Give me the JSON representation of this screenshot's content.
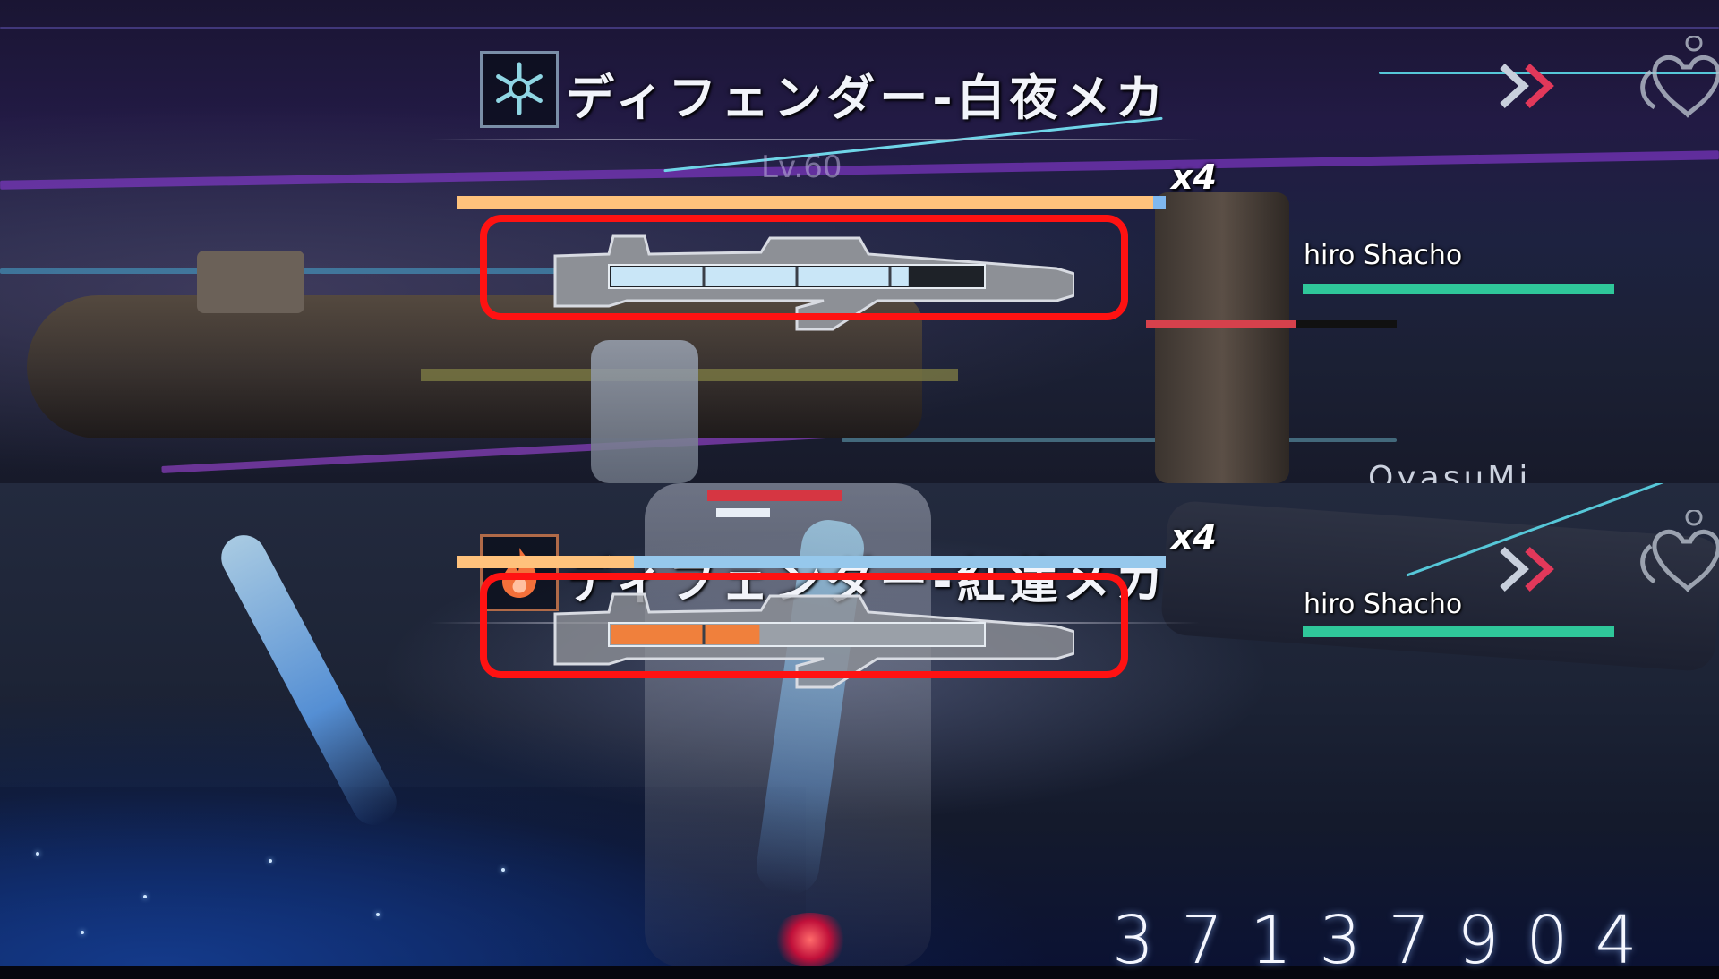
{
  "top_panel": {
    "boss": {
      "element_icon": "snowflake-icon",
      "name": "ディフェンダー-白夜メカ",
      "level": "Lv.60",
      "hp_multiplier": "x4",
      "hp_fill": 0.985,
      "weapon_gauge_fill": 0.8,
      "weapon_gauge_segments": 4,
      "weapon_gauge_color": "#c9e6f7"
    },
    "player": {
      "name": "hiro Shacho",
      "hp_fill": 1.0
    },
    "partial_text": "OyasuMi..."
  },
  "bottom_panel": {
    "boss": {
      "element_icon": "flame-icon",
      "name": "ディフェンダー-紅蓮メカ",
      "hp_multiplier": "x4",
      "hp_fill": 0.25,
      "weapon_gauge_fill": 0.4,
      "weapon_gauge_segments": 4,
      "weapon_gauge_color": "#f0803c"
    },
    "player": {
      "name": "hiro Shacho",
      "hp_fill": 1.0
    },
    "score": "37137904"
  },
  "colors": {
    "highlight": "#ff1212",
    "hp_orange": "#ffc27c",
    "hp_blue": "#96c8ec",
    "player_hp": "#2fc79a",
    "ice_accent": "#7ec4d8",
    "fire_accent": "#f2703a"
  }
}
